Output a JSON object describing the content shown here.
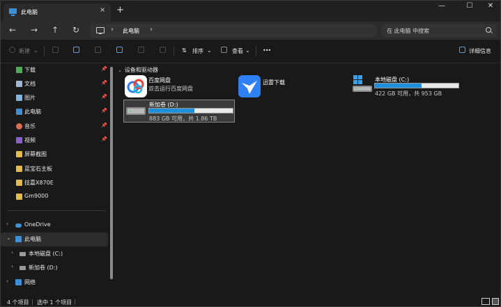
{
  "window": {
    "tab_title": "此电脑",
    "tab_close": "×",
    "new_tab": "+",
    "controls": {
      "minimize": "—",
      "maximize": "☐",
      "close": "✕"
    }
  },
  "nav": {
    "back": "←",
    "forward": "→",
    "up": "↑",
    "refresh": "↻",
    "address_sep": "›",
    "address_crumb": "此电脑",
    "search_placeholder": "在 此电脑 中搜索"
  },
  "toolbar": {
    "new_label": "新建",
    "sort_label": "排序",
    "view_label": "查看",
    "more_label": "•••",
    "details_label": "详细信息",
    "dropdown_caret": "⌄"
  },
  "sidebar": {
    "pin_glyph": "📌",
    "quick": [
      {
        "label": "下载",
        "pinned": true,
        "color": "#4caf50"
      },
      {
        "label": "文档",
        "pinned": true,
        "color": "#9fb7d6"
      },
      {
        "label": "图片",
        "pinned": true,
        "color": "#7ab8e6"
      },
      {
        "label": "此电脑",
        "pinned": true,
        "color": "#3d8fd6"
      },
      {
        "label": "音乐",
        "pinned": true,
        "color": "#e26b4f"
      },
      {
        "label": "视频",
        "pinned": true,
        "color": "#8c5fd1"
      },
      {
        "label": "屏幕截图",
        "pinned": false,
        "color": "#e7b948"
      },
      {
        "label": "蓝宝石主板",
        "pinned": false,
        "color": "#e7b948"
      },
      {
        "label": "技嘉X870E",
        "pinned": false,
        "color": "#e7b948"
      },
      {
        "label": "Gm9000",
        "pinned": false,
        "color": "#e7b948"
      }
    ],
    "tree": [
      {
        "label": "OneDrive",
        "chev": "›",
        "color": "#3d8fd6"
      },
      {
        "label": "此电脑",
        "chev": "⌄",
        "color": "#3d8fd6"
      },
      {
        "label": "本地磁盘 (C:)",
        "chev": "›",
        "color": "#9a9a9a"
      },
      {
        "label": "新加卷 (D:)",
        "chev": "›",
        "color": "#9a9a9a"
      },
      {
        "label": "网络",
        "chev": "›",
        "color": "#3d8fd6"
      }
    ]
  },
  "content": {
    "group_chev": "⌄",
    "group_title": "设备和驱动器",
    "baidu": {
      "name": "百度网盘",
      "sub": "双击运行百度网盘"
    },
    "xunlei": {
      "name": "迅雷下载"
    },
    "drive_c": {
      "name": "本地磁盘 (C:)",
      "info": "422 GB 可用，共 953 GB",
      "used_fraction": 0.56
    },
    "drive_d": {
      "name": "新加卷 (D:)",
      "info": "883 GB 可用，共 1.86 TB",
      "used_fraction": 0.54
    }
  },
  "status": {
    "count": "4 个项目",
    "selected": "选中 1 个项目"
  },
  "colors": {
    "accent": "#1f8fd9",
    "background": "#191919"
  }
}
